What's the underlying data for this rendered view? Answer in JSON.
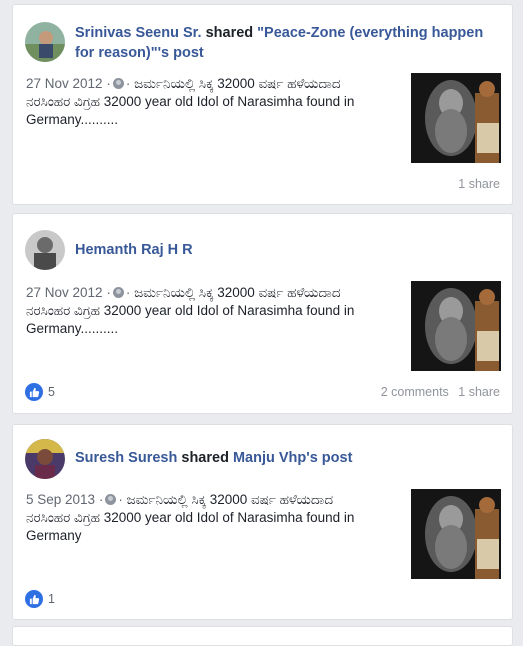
{
  "posts": [
    {
      "author": "Srinivas Seenu Sr.",
      "verb": "shared",
      "shared_source": "\"Peace-Zone (everything happen for reason)\"'s post",
      "date": "27 Nov 2012",
      "text_line1": "ಜರ್ಮನಿಯಲ್ಲಿ ಸಿಕ್ಕ 32000 ವರ್ಷ ಹಳೆಯದಾದ",
      "text_line2": "ನರಸಿಂಹರ ವಿಗ್ರಹ 32000 year old Idol of Narasimha found in",
      "text_line3": "Germany..........",
      "likes": "",
      "comments": "",
      "shares": "1 share"
    },
    {
      "author": "Hemanth Raj H R",
      "verb": "",
      "shared_source": "",
      "date": "27 Nov 2012",
      "text_line1": "ಜರ್ಮನಿಯಲ್ಲಿ ಸಿಕ್ಕ 32000 ವರ್ಷ ಹಳೆಯದಾದ",
      "text_line2": "ನರಸಿಂಹರ ವಿಗ್ರಹ 32000 year old Idol of Narasimha found in",
      "text_line3": "Germany..........",
      "likes": "5",
      "comments": "2 comments",
      "shares": "1 share"
    },
    {
      "author": "Suresh Suresh",
      "verb": "shared",
      "shared_source": "Manju Vhp's post",
      "date": "5 Sep 2013",
      "text_line1": "ಜರ್ಮನಿಯಲ್ಲಿ ಸಿಕ್ಕ 32000 ವರ್ಷ ಹಳೆಯದಾದ",
      "text_line2": "ನರಸಿಂಹರ ವಿಗ್ರಹ 32000 year old Idol of Narasimha found in",
      "text_line3": "Germany",
      "likes": "1",
      "comments": "",
      "shares": ""
    }
  ],
  "meta_separator": "·",
  "colors": {
    "link": "#385898",
    "like_blue": "#2f6fe4",
    "muted": "#90949c",
    "background": "#e9ebee"
  },
  "icons": {
    "privacy": "globe-icon",
    "like": "thumbs-up-icon"
  }
}
